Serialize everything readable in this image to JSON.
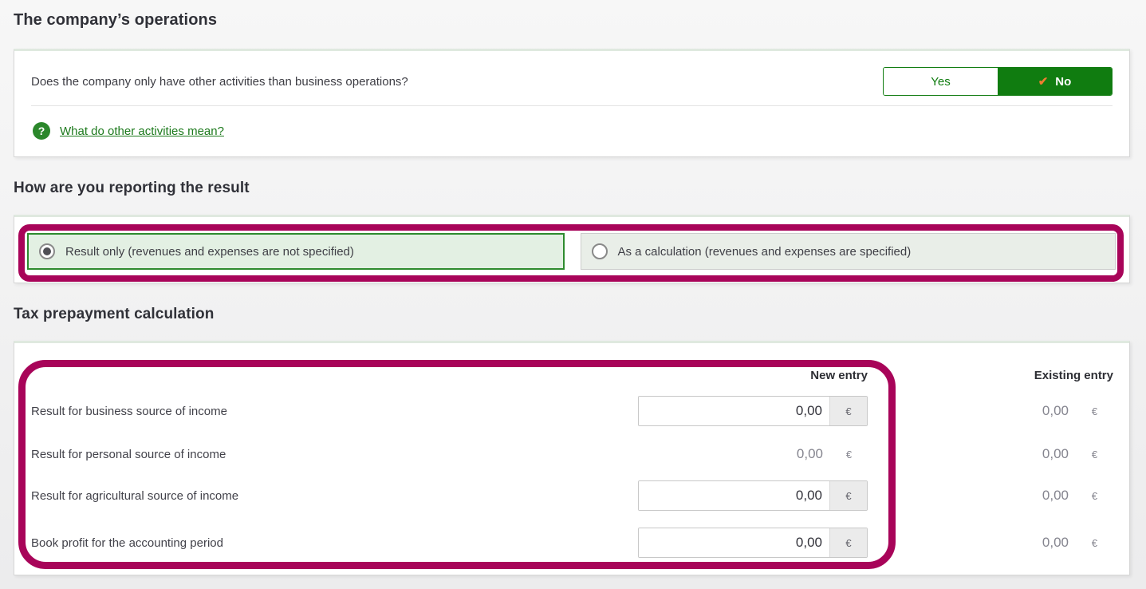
{
  "sections": {
    "operations": {
      "heading": "The company’s operations",
      "question": "Does the company only have other activities than business operations?",
      "toggle": {
        "yes": "Yes",
        "no": "No",
        "selected": "No",
        "check_icon": "✔"
      },
      "help": {
        "icon": "?",
        "link": "What do other activities mean?"
      }
    },
    "reporting": {
      "heading": "How are you reporting the result",
      "options": [
        {
          "label": "Result only (revenues and expenses are not specified)",
          "selected": true
        },
        {
          "label": "As a calculation (revenues and expenses are specified)",
          "selected": false
        }
      ]
    },
    "prepayment": {
      "heading": "Tax prepayment calculation",
      "columns": {
        "new": "New entry",
        "existing": "Existing entry"
      },
      "currency": "€",
      "rows": [
        {
          "label": "Result for business source of income",
          "new_value": "0,00",
          "editable": true,
          "existing_value": "0,00"
        },
        {
          "label": "Result for personal source of income",
          "new_value": "0,00",
          "editable": false,
          "existing_value": "0,00"
        },
        {
          "label": "Result for agricultural source of income",
          "new_value": "0,00",
          "editable": true,
          "existing_value": "0,00"
        },
        {
          "label": "Book profit for the accounting period",
          "new_value": "0,00",
          "editable": true,
          "existing_value": "0,00"
        }
      ]
    }
  },
  "colors": {
    "accent_green": "#107c10",
    "selected_option_bg": "#e3f0e3",
    "unselected_option_bg": "#e9eee8",
    "annotation_magenta": "#a80459",
    "check_orange": "#ed7d31",
    "link_green": "#1d7a1d"
  }
}
